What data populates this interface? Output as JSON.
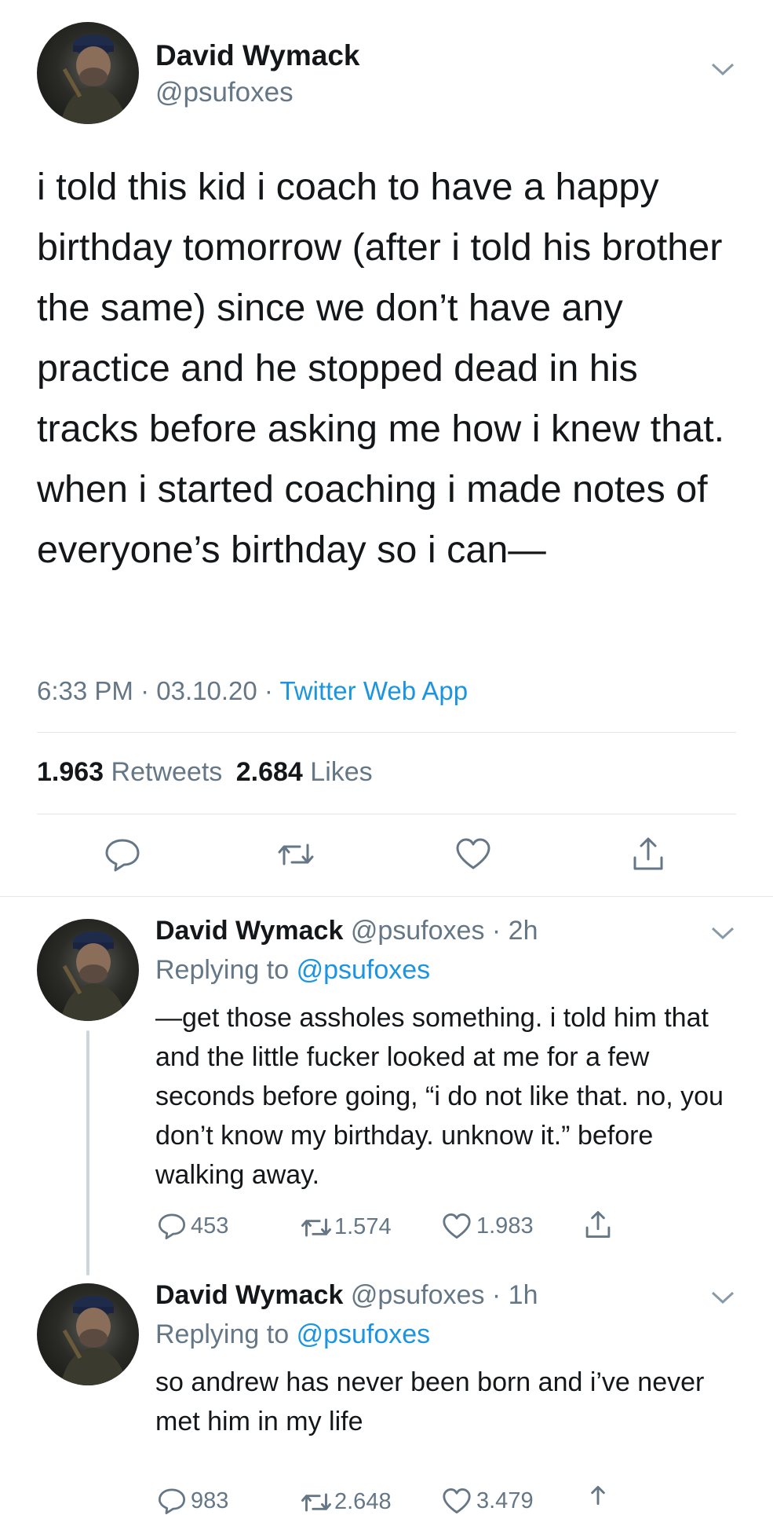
{
  "main_tweet": {
    "author_name": "David Wymack",
    "handle": "@psufoxes",
    "text": "i told this kid i coach to have a happy birthday tomorrow (after i told his brother the same) since we don’t have any practice and he stopped dead in his tracks before asking me how i knew that. when i started coaching i made notes of everyone’s birthday so i can—",
    "time": "6:33 PM",
    "date": "03.10.20",
    "sep": "·",
    "source": "Twitter Web App",
    "retweets_count": "1.963",
    "retweets_label": "Retweets",
    "likes_count": "2.684",
    "likes_label": "Likes"
  },
  "replies": [
    {
      "author_name": "David Wymack",
      "handle_time": "@psufoxes · 2h",
      "replying_prefix": "Replying to",
      "replying_to": "@psufoxes",
      "text": "—get those assholes something. i told him that and the little fucker looked at me for a few seconds before going, “i do not like that. no, you don’t know my birthday. unknow it.” before walking away.",
      "reply_count": "453",
      "retweet_count": "1.574",
      "like_count": "1.983"
    },
    {
      "author_name": "David Wymack",
      "handle_time": "@psufoxes · 1h",
      "replying_prefix": "Replying to",
      "replying_to": "@psufoxes",
      "text": "so andrew has never been born and i’ve never met him in my life",
      "reply_count": "983",
      "retweet_count": "2.648",
      "like_count": "3.479"
    }
  ],
  "icons": {
    "reply": "reply-icon",
    "retweet": "retweet-icon",
    "like": "heart-icon",
    "share": "share-icon",
    "more": "chevron-down-icon"
  },
  "colors": {
    "link": "#1b95e0",
    "secondary_text": "#657786",
    "divider": "#e1e8ed"
  }
}
